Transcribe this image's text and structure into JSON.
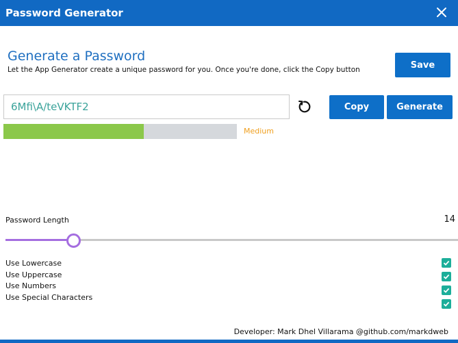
{
  "window": {
    "title": "Password Generator",
    "close_icon": "close-icon"
  },
  "header": {
    "title": "Generate a Password",
    "subtitle": "Let the App Generator create a unique password for you. Once you're done, click the Copy button"
  },
  "toolbar": {
    "save_label": "Save",
    "copy_label": "Copy",
    "generate_label": "Generate"
  },
  "password": {
    "value": "6Mfi\\A/teVKTF2",
    "refresh_icon": "refresh-icon"
  },
  "strength": {
    "label": "Medium",
    "level": 0.6,
    "color": "#8bc84a",
    "label_color": "#f0a020"
  },
  "length": {
    "label": "Password Length",
    "value": "14",
    "slider_fraction": 0.15
  },
  "options": [
    {
      "label": "Use Lowercase",
      "checked": true
    },
    {
      "label": "Use Uppercase",
      "checked": true
    },
    {
      "label": "Use Numbers",
      "checked": true
    },
    {
      "label": "Use Special Characters",
      "checked": true
    }
  ],
  "footer": {
    "text": "Developer: Mark Dhel Villarama @github.com/markdweb"
  },
  "colors": {
    "accent": "#1169c3",
    "button": "#0e6fc8",
    "slider": "#a56ee0",
    "checkbox": "#1cae9a"
  }
}
